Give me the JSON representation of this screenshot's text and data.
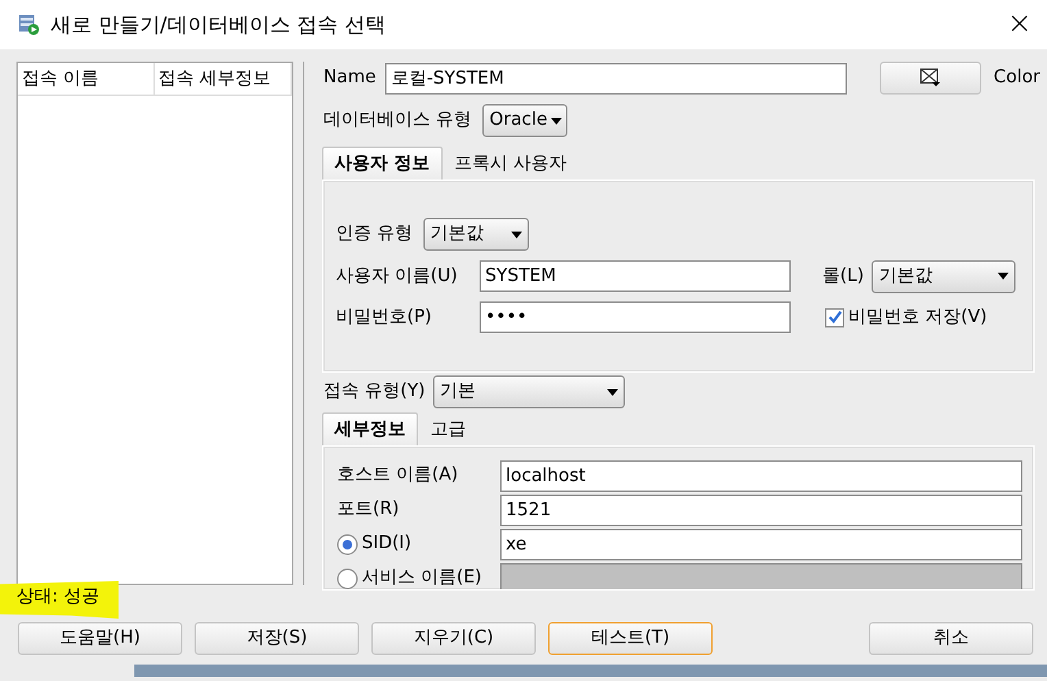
{
  "window": {
    "title": "새로 만들기/데이터베이스 접속 선택",
    "close": "×"
  },
  "connection_list": {
    "columns": [
      "접속 이름",
      "접속 세부정보"
    ]
  },
  "name": {
    "label": "Name",
    "value": "로컬-SYSTEM"
  },
  "color": {
    "label": "Color"
  },
  "database_type": {
    "label": "데이터베이스 유형",
    "value": "Oracle"
  },
  "user_tabs": [
    {
      "label": "사용자 정보",
      "selected": true
    },
    {
      "label": "프록시 사용자",
      "selected": false
    }
  ],
  "auth_type": {
    "label": "인증 유형",
    "value": "기본값"
  },
  "username": {
    "label": "사용자 이름(U)",
    "value": "SYSTEM"
  },
  "role": {
    "label": "롤(L)",
    "value": "기본값"
  },
  "password": {
    "label": "비밀번호(P)",
    "value": "••••"
  },
  "save_password": {
    "label": "비밀번호 저장(V)",
    "checked": true
  },
  "connection_type": {
    "label": "접속 유형(Y)",
    "value": "기본"
  },
  "detail_tabs": [
    {
      "label": "세부정보",
      "selected": true
    },
    {
      "label": "고급",
      "selected": false
    }
  ],
  "details": [
    {
      "kind": "field",
      "label": "호스트 이름(A)",
      "value": "localhost"
    },
    {
      "kind": "field",
      "label": "포트(R)",
      "value": "1521"
    },
    {
      "kind": "radio",
      "label": "SID(I)",
      "value": "xe",
      "selected": true,
      "disabled": false
    },
    {
      "kind": "radio",
      "label": "서비스 이름(E)",
      "selected": false,
      "disabled": true
    }
  ],
  "status": "상태: 성공",
  "buttons": [
    {
      "label": "도움말(H)",
      "focused": false
    },
    {
      "label": "저장(S)",
      "focused": false
    },
    {
      "label": "지우기(C)",
      "focused": false
    },
    {
      "label": "테스트(T)",
      "focused": true
    },
    {
      "label": "취소",
      "focused": false
    }
  ]
}
